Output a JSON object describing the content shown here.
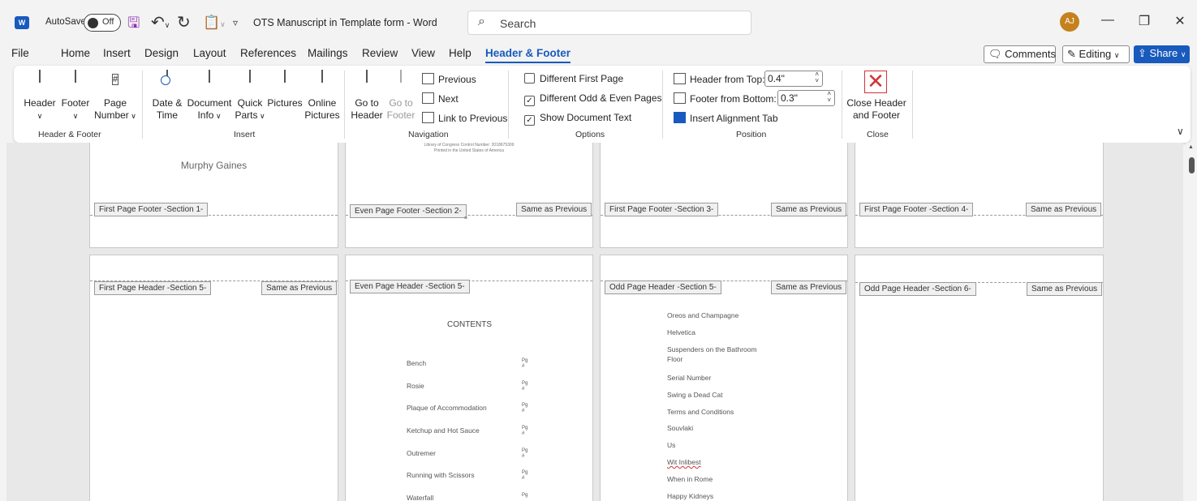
{
  "titlebar": {
    "app_icon": "word-icon",
    "autosave_label": "AutoSave",
    "autosave_state": "Off",
    "doc_title": "OTS Manuscript in Template form  -  Word",
    "search_placeholder": "Search",
    "avatar_initials": "AJ"
  },
  "tabs": [
    "File",
    "Home",
    "Insert",
    "Design",
    "Layout",
    "References",
    "Mailings",
    "Review",
    "View",
    "Help",
    "Header & Footer"
  ],
  "right_buttons": {
    "comments": "Comments",
    "editing": "Editing",
    "share": "Share"
  },
  "ribbon": {
    "header_footer": {
      "label": "Header & Footer",
      "header": "Header",
      "footer": "Footer",
      "page_number_1": "Page",
      "page_number_2": "Number"
    },
    "insert": {
      "label": "Insert",
      "date_1": "Date &",
      "date_2": "Time",
      "docinfo_1": "Document",
      "docinfo_2": "Info",
      "quick_1": "Quick",
      "quick_2": "Parts",
      "pictures": "Pictures",
      "online_1": "Online",
      "online_2": "Pictures"
    },
    "navigation": {
      "label": "Navigation",
      "goto_header_1": "Go to",
      "goto_header_2": "Header",
      "goto_footer_1": "Go to",
      "goto_footer_2": "Footer",
      "previous": "Previous",
      "next": "Next",
      "link": "Link to Previous"
    },
    "options": {
      "label": "Options",
      "diff_first": "Different First Page",
      "diff_first_checked": false,
      "diff_odd_even": "Different Odd & Even Pages",
      "diff_odd_even_checked": true,
      "show_doc_text": "Show Document Text",
      "show_doc_text_checked": true
    },
    "position": {
      "label": "Position",
      "header_from_top": "Header from Top:",
      "header_value": "0.4\"",
      "footer_from_bottom": "Footer from Bottom:",
      "footer_value": "0.3\"",
      "alignment_tab": "Insert Alignment Tab"
    },
    "close": {
      "label": "Close",
      "close_1": "Close Header",
      "close_2": "and Footer"
    }
  },
  "document": {
    "page1_text": "Murphy Gaines",
    "page2_small_1": "Library of Congress Control Number: 2018675309",
    "page2_small_2": "Printed in the United States of America",
    "page2_mark": "¤",
    "footer_tags": [
      "First Page Footer -Section 1-",
      "Even Page Footer -Section 2-",
      "First Page Footer -Section 3-",
      "First Page Footer -Section 4-"
    ],
    "header_tags": [
      "First Page Header -Section 5-",
      "Even Page Header -Section 5-",
      "Odd Page Header -Section 5-",
      "Odd Page Header -Section 6-"
    ],
    "same_as_previous": "Same as Previous",
    "contents_title": "CONTENTS",
    "toc_items": [
      "Bench",
      "Rosie",
      "Plaque of Accommodation",
      "Ketchup and Hot Sauce",
      "Outremer",
      "Running with Scissors",
      "Waterfall"
    ],
    "toc_pg_1": "Pg",
    "toc_pg_2": "#",
    "list_items": [
      "Oreos and Champagne",
      "Helvetica",
      "Suspenders on the Bathroom",
      "Floor",
      "Serial Number",
      "Swing a Dead Cat",
      "Terms and Conditions",
      "Souvlaki",
      "Us",
      "Wit Inlibest",
      "When in Rome",
      "Happy Kidneys"
    ]
  }
}
